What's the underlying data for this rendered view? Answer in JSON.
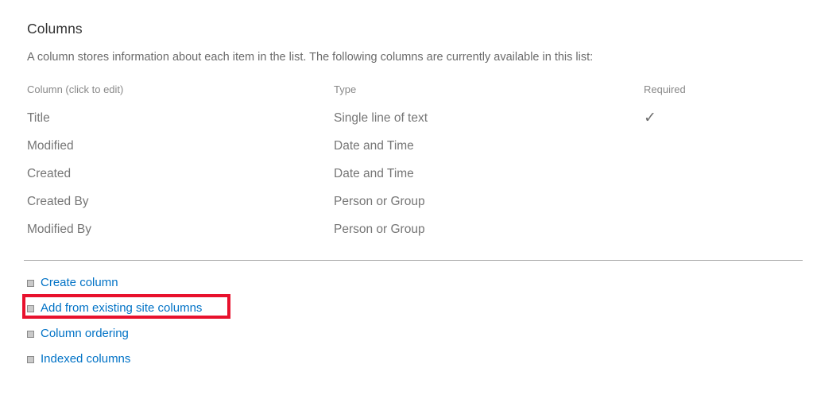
{
  "section": {
    "title": "Columns",
    "description": "A column stores information about each item in the list. The following columns are currently available in this list:"
  },
  "table": {
    "headers": {
      "name": "Column (click to edit)",
      "type": "Type",
      "required": "Required"
    },
    "rows": [
      {
        "name": "Title",
        "type": "Single line of text",
        "required": "✓"
      },
      {
        "name": "Modified",
        "type": "Date and Time",
        "required": ""
      },
      {
        "name": "Created",
        "type": "Date and Time",
        "required": ""
      },
      {
        "name": "Created By",
        "type": "Person or Group",
        "required": ""
      },
      {
        "name": "Modified By",
        "type": "Person or Group",
        "required": ""
      }
    ]
  },
  "links": [
    {
      "label": "Create column",
      "icon": "bullet-square-icon"
    },
    {
      "label": "Add from existing site columns",
      "icon": "bullet-square-icon"
    },
    {
      "label": "Column ordering",
      "icon": "bullet-square-icon"
    },
    {
      "label": "Indexed columns",
      "icon": "bullet-square-icon"
    }
  ],
  "annotation": {
    "target": "Add from existing site columns",
    "color": "#e8112d"
  },
  "colors": {
    "link": "#0072c6",
    "heading": "#333333",
    "body_text": "#6b6b6b",
    "table_text": "#767676",
    "table_header_text": "#888888",
    "divider": "#a6a6a6",
    "highlight": "#e8112d",
    "background": "#ffffff"
  }
}
